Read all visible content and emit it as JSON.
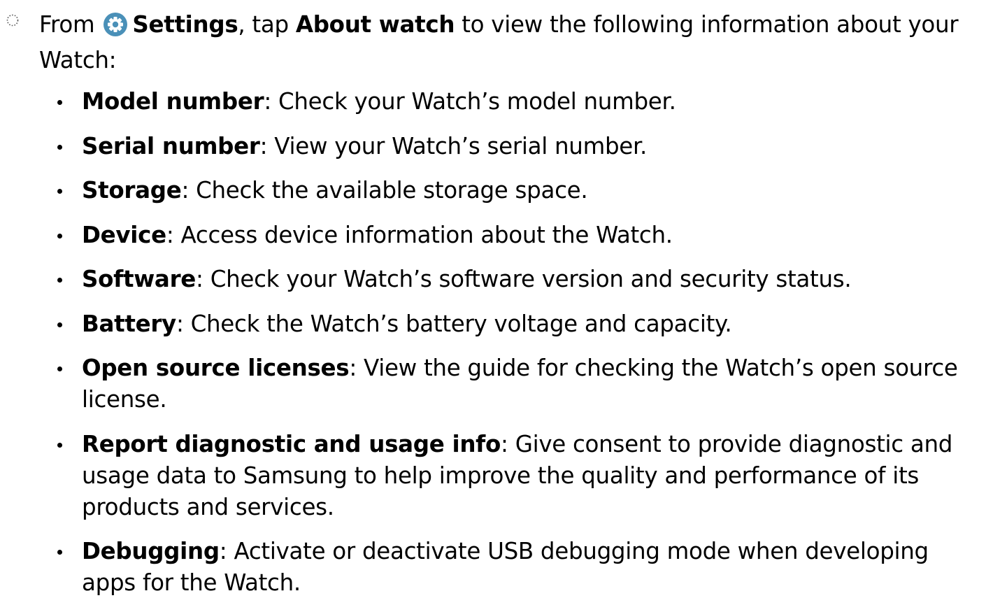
{
  "step": {
    "marker_icon": "dotted-circle-step-icon",
    "prefix": "From",
    "settings_icon": "gear-icon",
    "settings_icon_color": "#4a90b8",
    "settings_label": "Settings",
    "middle": ", tap",
    "about_label": "About watch",
    "suffix": "to view the following information about your Watch:"
  },
  "items": [
    {
      "term": "Model number",
      "description": ": Check your Watch’s model number."
    },
    {
      "term": "Serial number",
      "description": ": View your Watch’s serial number."
    },
    {
      "term": "Storage",
      "description": ": Check the available storage space."
    },
    {
      "term": "Device",
      "description": ": Access device information about the Watch."
    },
    {
      "term": "Software",
      "description": ": Check your Watch’s software version and security status."
    },
    {
      "term": "Battery",
      "description": ": Check the Watch’s battery voltage and capacity."
    },
    {
      "term": "Open source licenses",
      "description": ": View the guide for checking the Watch’s open source license."
    },
    {
      "term": "Report diagnostic and usage info",
      "description": ": Give consent to provide diagnostic and usage data to Samsung to help improve the quality and performance of its products and services."
    },
    {
      "term": "Debugging",
      "description": ": Activate or deactivate USB debugging mode when developing apps for the Watch."
    }
  ]
}
